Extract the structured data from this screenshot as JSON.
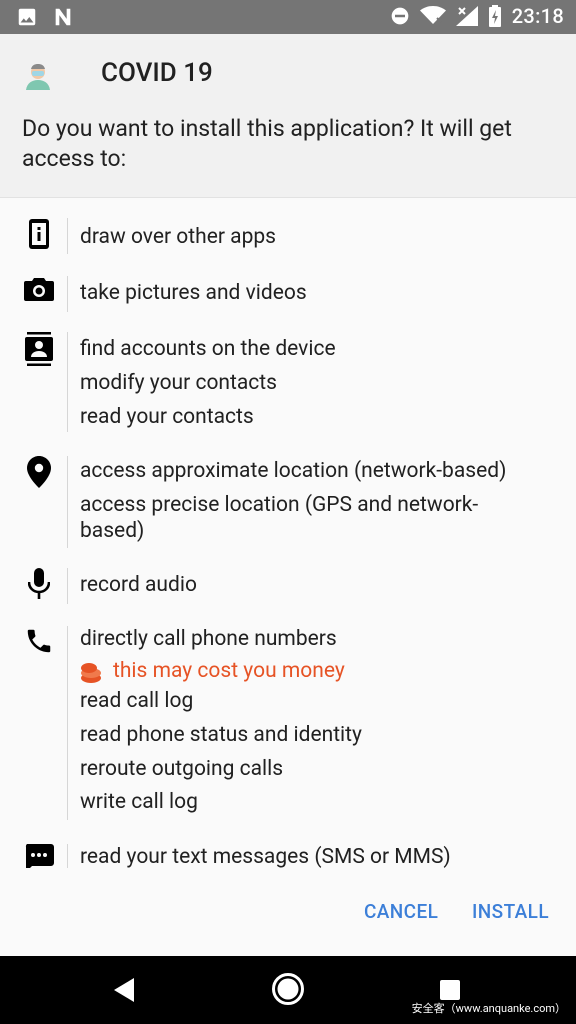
{
  "status_bar": {
    "time": "23:18"
  },
  "dialog": {
    "app_name": "COVID 19",
    "prompt": "Do you want to install this application? It will get access to:"
  },
  "permissions": {
    "overlay": [
      "draw over other apps"
    ],
    "camera": [
      "take pictures and videos"
    ],
    "contacts": [
      "find accounts on the device",
      "modify your contacts",
      "read your contacts"
    ],
    "location": [
      "access approximate location (network-based)",
      "access precise location (GPS and network-based)"
    ],
    "microphone": [
      "record audio"
    ],
    "phone": {
      "first": "directly call phone numbers",
      "warning": "this may cost you money",
      "rest": [
        "read call log",
        "read phone status and identity",
        "reroute outgoing calls",
        "write call log"
      ]
    },
    "sms": [
      "read your text messages (SMS or MMS)"
    ]
  },
  "buttons": {
    "cancel": "CANCEL",
    "install": "INSTALL"
  },
  "watermark": "安全客（www.anquanke.com）",
  "icons": {
    "status_left": [
      "image-icon",
      "n-notification-icon"
    ],
    "status_right": [
      "do-not-disturb-icon",
      "wifi-icon",
      "signal-icon",
      "battery-charging-icon"
    ],
    "groups": [
      "overlay-icon",
      "camera-icon",
      "contacts-icon",
      "location-icon",
      "microphone-icon",
      "phone-icon",
      "sms-icon"
    ]
  },
  "colors": {
    "accent": "#3c7fd8",
    "warning": "#e65325",
    "status_bar": "#757575"
  }
}
